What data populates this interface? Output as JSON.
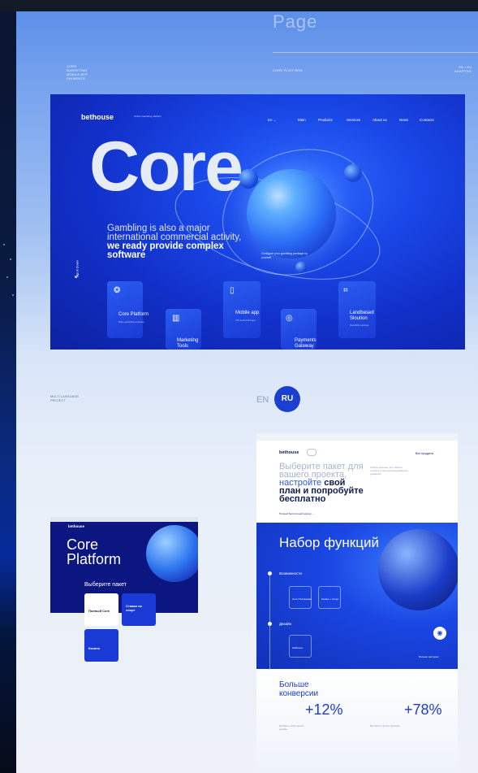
{
  "ghost_title": "Page",
  "meta": {
    "left": [
      "CORE",
      "MARKETING",
      "MOBILE APP",
      "PAYMENTS"
    ],
    "middle": "CORE PLATFORM",
    "right": [
      "EN / RU",
      "ADAPTIVE"
    ],
    "multi": [
      "MULTI LANGUAGE",
      "PROJECT"
    ]
  },
  "hero": {
    "brand": "bethouse",
    "brand_sub": "Online Gambling platform",
    "lang": "En ⌄",
    "nav": [
      "Main",
      "Products",
      "Services",
      "About us",
      "News",
      "Contacts"
    ],
    "core": "Core",
    "scroll": "Scroll Down",
    "tagline_plain": "Gambling is also a major international commercial activity,",
    "tagline_bold": "we ready provide complex software",
    "configure": "Configure your gambling package by yourself",
    "cards": [
      {
        "label": "Core Platform",
        "sub": "Base gambling software"
      },
      {
        "label": "Marketing Tools",
        "sub": ""
      },
      {
        "label": "Mobile app",
        "sub": "iOS & Android app"
      },
      {
        "label": "Payments Gateway",
        "sub": ""
      },
      {
        "label": "Landbased Sloution",
        "sub": "Flexibility settings"
      }
    ]
  },
  "languages": {
    "en": "EN",
    "ru": "RU"
  },
  "small_mock": {
    "brand": "bethouse",
    "title_line1": "Core",
    "title_line2": "Platform",
    "subtitle": "Выберите пакет",
    "card1": "Полный Core",
    "card2": "Ставки на спорт",
    "card3": "Казино"
  },
  "ru_mock": {
    "brand": "bethouse",
    "right": "Все продукты",
    "h1_grey": "Выберите пакет для вашего проекта,",
    "h1_blue": "настройте",
    "h1_bold": "свой план и попробуйте бесплатно",
    "small": "Гибкое решение для любого проекта с персонализированным дизайном",
    "link": "Полный бесплатный период →",
    "features": "Набор функций",
    "sect1": "Возможности",
    "sect2": "Дизайн",
    "box1": "Core Платформа",
    "box2": "Казино + Спорт",
    "box3": "Шаблоны",
    "more": "Больше настроек",
    "conv_line1": "Больше",
    "conv_line2": "конверсии",
    "stat1": "+12%",
    "stat1_lbl": "Добавьте мобильный дизайн",
    "stat2": "+78%",
    "stat2_lbl": "Выберите просто функции"
  }
}
